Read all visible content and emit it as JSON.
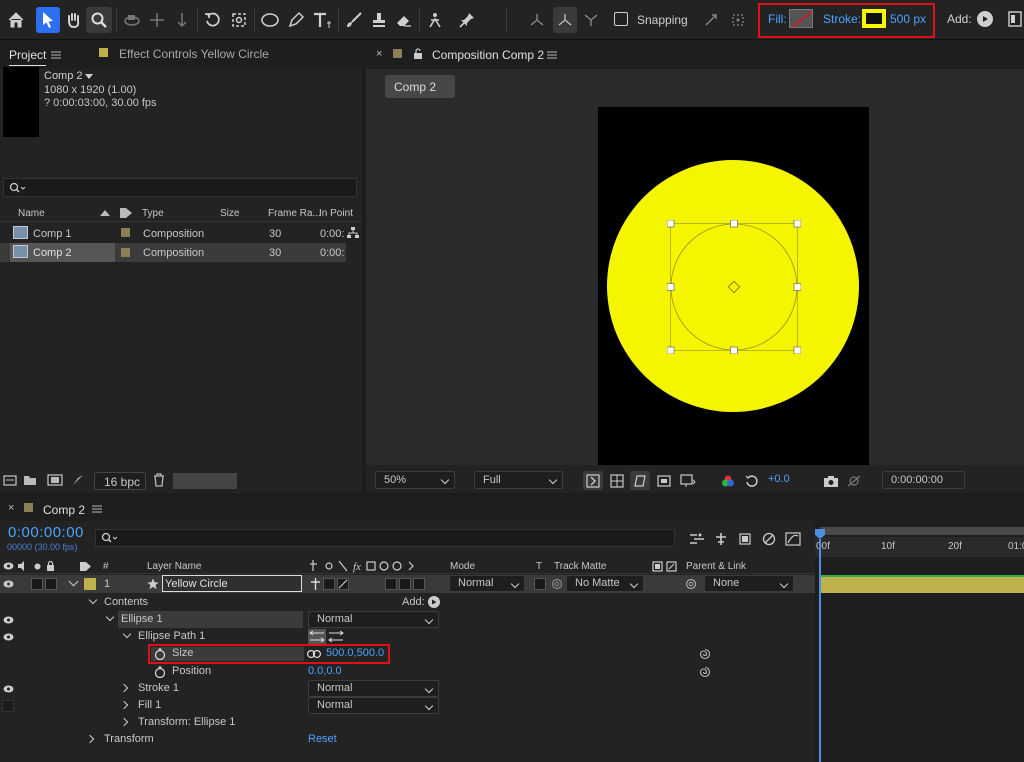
{
  "toolbar": {
    "snapping_label": "Snapping",
    "fill_label": "Fill:",
    "stroke_label": "Stroke:",
    "stroke_width": "500 px",
    "add_label": "Add:",
    "accent_color": "#4aa3ff",
    "highlight_color": "#e0101a",
    "stroke_color": "#f7f700",
    "tools": [
      "home-icon",
      "selection-tool-icon",
      "hand-tool-icon",
      "zoom-tool-icon",
      "orbit-camera-icon",
      "pan-camera-icon",
      "dolly-camera-icon",
      "rotation-tool-icon",
      "pan-behind-icon",
      "ellipse-tool-icon",
      "pen-tool-icon",
      "type-tool-icon",
      "brush-tool-icon",
      "clone-stamp-icon",
      "eraser-tool-icon",
      "roto-brush-icon",
      "puppet-pin-icon"
    ]
  },
  "project": {
    "tab_label": "Project",
    "effect_controls_label": "Effect Controls Yellow Circle",
    "comp_name": "Comp 2",
    "comp_size": "1080 x 1920 (1.00)",
    "comp_duration": "? 0:00:03:00, 30.00 fps",
    "search_placeholder": "",
    "columns": [
      "Name",
      "Type",
      "Size",
      "Frame Ra...",
      "In Point"
    ],
    "items": [
      {
        "name": "Comp 1",
        "type": "Composition",
        "frame_rate": "30",
        "in_point": "0:00:"
      },
      {
        "name": "Comp 2",
        "type": "Composition",
        "frame_rate": "30",
        "in_point": "0:00:"
      }
    ],
    "bpc_label": "16 bpc"
  },
  "viewer": {
    "tab_label": "Composition Comp 2",
    "comp_button": "Comp 2",
    "zoom": "50%",
    "resolution": "Full",
    "exposure": "+0.0",
    "timecode": "0:00:00:00",
    "circle_color": "#f5f500"
  },
  "timeline": {
    "tab_label": "Comp 2",
    "timecode": "0:00:00:00",
    "frame_info": "00000 (30.00 fps)",
    "search_placeholder": "",
    "col_layer_name": "Layer Name",
    "col_hash": "#",
    "col_mode": "Mode",
    "col_t": "T",
    "col_track_matte": "Track Matte",
    "col_parent": "Parent & Link",
    "ruler": [
      "00f",
      "10f",
      "20f",
      "01:0"
    ],
    "layer": {
      "num": "1",
      "name": "Yellow Circle",
      "mode": "Normal",
      "matte": "No Matte",
      "parent": "None",
      "label_color": "#bdb24a"
    },
    "rows": {
      "contents": "Contents",
      "add": "Add:",
      "ellipse1": "Ellipse 1",
      "ellipse1_mode": "Normal",
      "ellipse_path": "Ellipse Path 1",
      "size_label": "Size",
      "size_value": "500.0,500.0",
      "position_label": "Position",
      "position_value": "0.0,0.0",
      "stroke1": "Stroke 1",
      "stroke1_mode": "Normal",
      "fill1": "Fill 1",
      "fill1_mode": "Normal",
      "transform_ellipse": "Transform: Ellipse 1",
      "transform": "Transform",
      "reset": "Reset"
    }
  }
}
